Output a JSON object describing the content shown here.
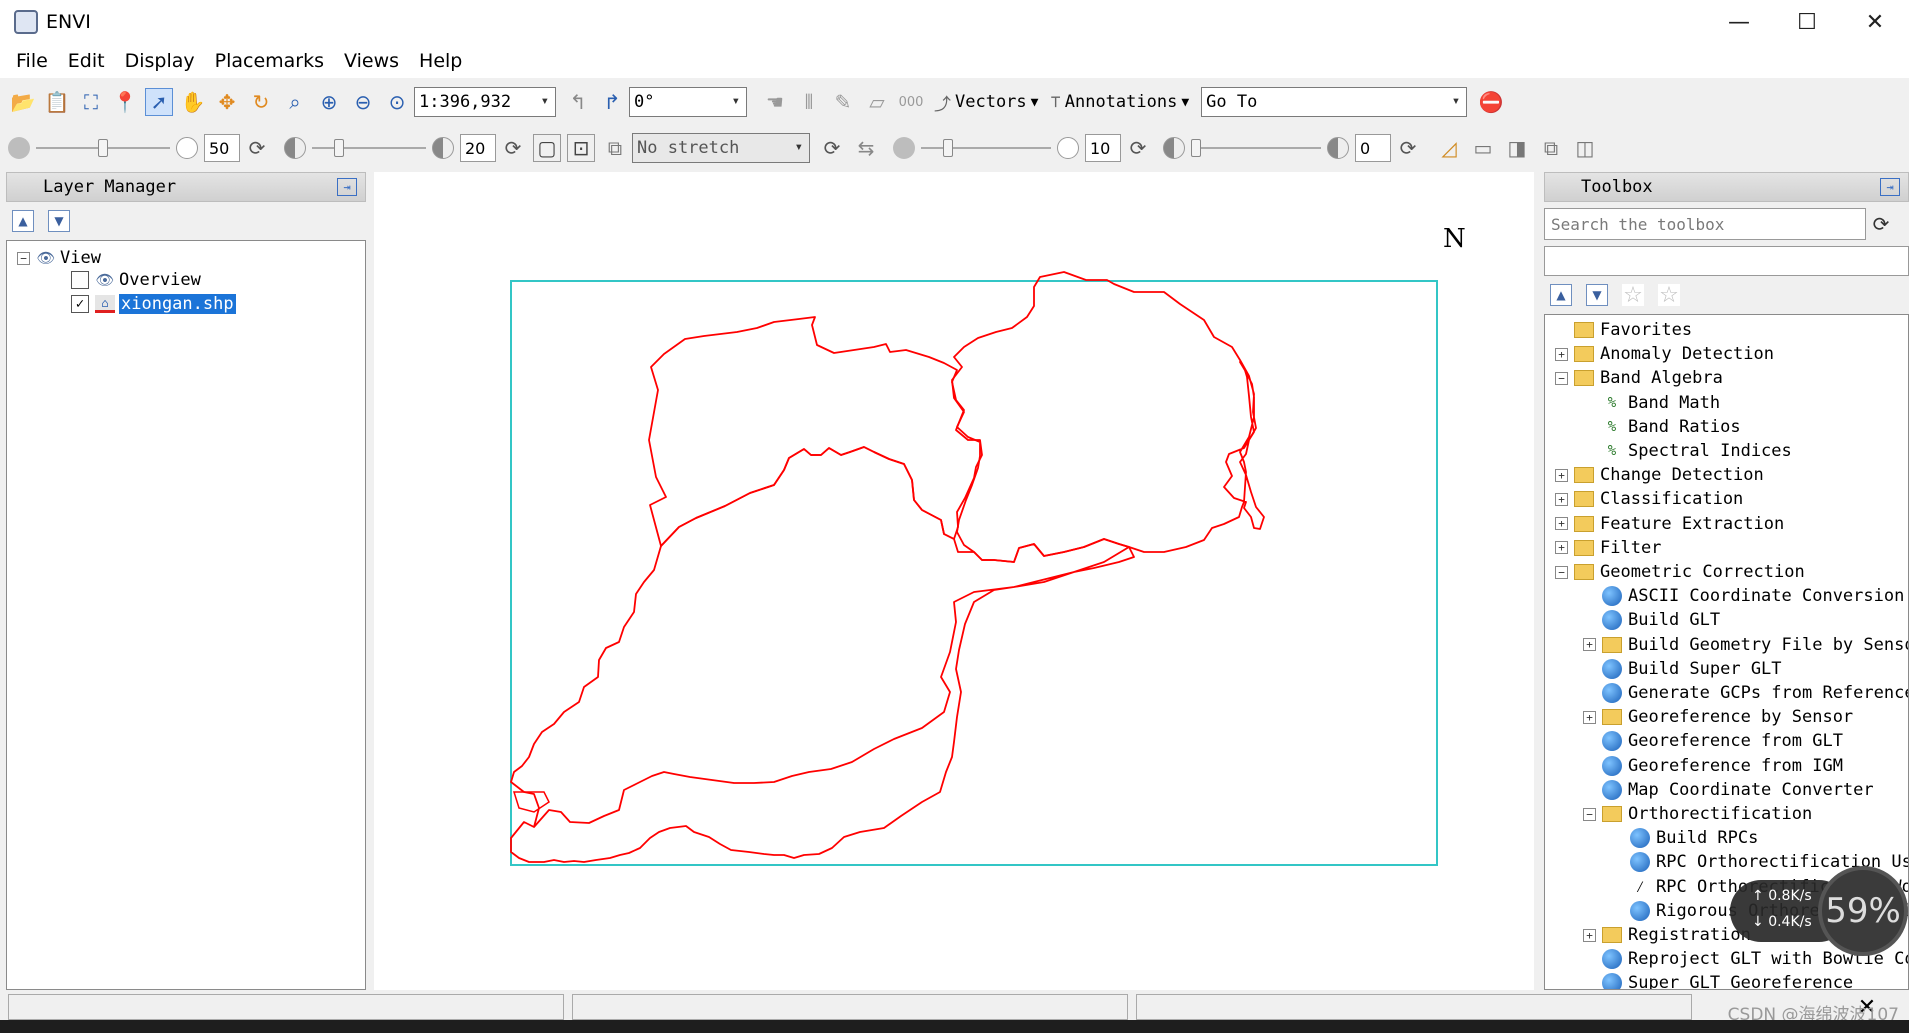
{
  "window": {
    "title": "ENVI",
    "minimize": "—",
    "maximize": "☐",
    "close": "✕"
  },
  "menu": [
    "File",
    "Edit",
    "Display",
    "Placemarks",
    "Views",
    "Help"
  ],
  "toolbar1": {
    "scale_value": "1:396,932",
    "rotation_value": "0°",
    "vectors_label": "Vectors",
    "annotations_label": "Annotations",
    "goto_value": "Go To"
  },
  "toolbar2": {
    "brightness_value": "50",
    "contrast_value": "20",
    "stretch_value": "No stretch",
    "sharpen_value": "10",
    "transparency_value": "0"
  },
  "layer_manager": {
    "title": "Layer Manager",
    "tree": [
      {
        "label": "View",
        "icon": "view-icon"
      },
      {
        "label": "Overview",
        "icon": "overview-eye-icon",
        "checked": false
      },
      {
        "label": "xiongan.shp",
        "icon": "shapefile-icon",
        "checked": true,
        "selected": true
      }
    ]
  },
  "map": {
    "north_label": "N",
    "boundary_color": "#ff0000",
    "frame_color": "#33c6c6"
  },
  "toolbox": {
    "title": "Toolbox",
    "search_placeholder": "Search the toolbox",
    "items": [
      {
        "label": "Favorites",
        "level": 0,
        "type": "favorites-folder",
        "expander": ""
      },
      {
        "label": "Anomaly Detection",
        "level": 0,
        "type": "folder",
        "expander": "+"
      },
      {
        "label": "Band Algebra",
        "level": 0,
        "type": "folder",
        "expander": "−"
      },
      {
        "label": "Band Math",
        "level": 1,
        "type": "ratio-tool",
        "expander": ""
      },
      {
        "label": "Band Ratios",
        "level": 1,
        "type": "ratio-tool",
        "expander": ""
      },
      {
        "label": "Spectral Indices",
        "level": 1,
        "type": "ratio-tool",
        "expander": ""
      },
      {
        "label": "Change Detection",
        "level": 0,
        "type": "folder",
        "expander": "+"
      },
      {
        "label": "Classification",
        "level": 0,
        "type": "folder",
        "expander": "+"
      },
      {
        "label": "Feature Extraction",
        "level": 0,
        "type": "folder",
        "expander": "+"
      },
      {
        "label": "Filter",
        "level": 0,
        "type": "folder",
        "expander": "+"
      },
      {
        "label": "Geometric Correction",
        "level": 0,
        "type": "folder",
        "expander": "−"
      },
      {
        "label": "ASCII Coordinate Conversion",
        "level": 1,
        "type": "globe-tool",
        "expander": ""
      },
      {
        "label": "Build GLT",
        "level": 1,
        "type": "globe-tool",
        "expander": ""
      },
      {
        "label": "Build Geometry File by Sensor",
        "level": 1,
        "type": "folder",
        "expander": "+"
      },
      {
        "label": "Build Super GLT",
        "level": 1,
        "type": "globe-tool",
        "expander": ""
      },
      {
        "label": "Generate GCPs from Reference I",
        "level": 1,
        "type": "globe-tool",
        "expander": ""
      },
      {
        "label": "Georeference by Sensor",
        "level": 1,
        "type": "folder",
        "expander": "+"
      },
      {
        "label": "Georeference from GLT",
        "level": 1,
        "type": "globe-tool",
        "expander": ""
      },
      {
        "label": "Georeference from IGM",
        "level": 1,
        "type": "globe-tool",
        "expander": ""
      },
      {
        "label": "Map Coordinate Converter",
        "level": 1,
        "type": "globe-tool",
        "expander": ""
      },
      {
        "label": "Orthorectification",
        "level": 1,
        "type": "folder",
        "expander": "−"
      },
      {
        "label": "Build RPCs",
        "level": 2,
        "type": "globe-tool",
        "expander": ""
      },
      {
        "label": "RPC Orthorectification Usin",
        "level": 2,
        "type": "globe-tool",
        "expander": ""
      },
      {
        "label": "RPC Orthorectification Work",
        "level": 2,
        "type": "wand-tool",
        "expander": ""
      },
      {
        "label": "Rigorous Orthorectification",
        "level": 2,
        "type": "globe-tool",
        "expander": ""
      },
      {
        "label": "Registration",
        "level": 1,
        "type": "folder",
        "expander": "+"
      },
      {
        "label": "Reproject GLT with Bowtie Corr",
        "level": 1,
        "type": "globe-tool",
        "expander": ""
      },
      {
        "label": "Super GLT Georeference",
        "level": 1,
        "type": "globe-tool",
        "expander": ""
      }
    ]
  },
  "network_widget": {
    "upload": "0.8K/s",
    "download": "0.4K/s",
    "percent": "59%"
  },
  "watermark": "CSDN @海绵波波107"
}
